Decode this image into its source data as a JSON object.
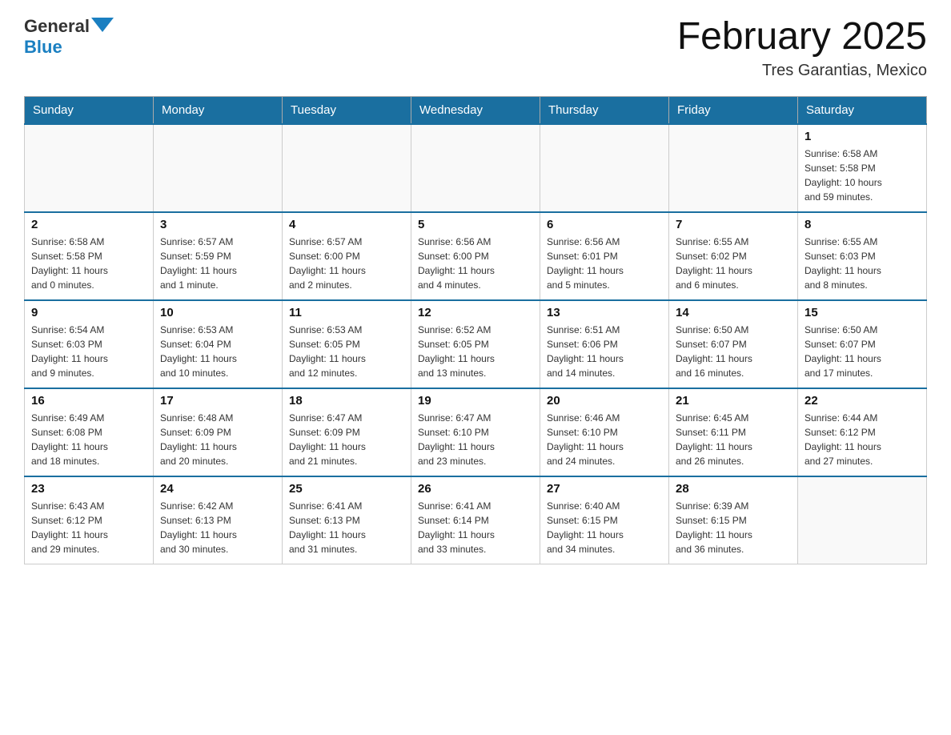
{
  "header": {
    "logo_general": "General",
    "logo_blue": "Blue",
    "month_title": "February 2025",
    "location": "Tres Garantias, Mexico"
  },
  "days_of_week": [
    "Sunday",
    "Monday",
    "Tuesday",
    "Wednesday",
    "Thursday",
    "Friday",
    "Saturday"
  ],
  "weeks": [
    [
      {
        "day": "",
        "info": ""
      },
      {
        "day": "",
        "info": ""
      },
      {
        "day": "",
        "info": ""
      },
      {
        "day": "",
        "info": ""
      },
      {
        "day": "",
        "info": ""
      },
      {
        "day": "",
        "info": ""
      },
      {
        "day": "1",
        "info": "Sunrise: 6:58 AM\nSunset: 5:58 PM\nDaylight: 10 hours\nand 59 minutes."
      }
    ],
    [
      {
        "day": "2",
        "info": "Sunrise: 6:58 AM\nSunset: 5:58 PM\nDaylight: 11 hours\nand 0 minutes."
      },
      {
        "day": "3",
        "info": "Sunrise: 6:57 AM\nSunset: 5:59 PM\nDaylight: 11 hours\nand 1 minute."
      },
      {
        "day": "4",
        "info": "Sunrise: 6:57 AM\nSunset: 6:00 PM\nDaylight: 11 hours\nand 2 minutes."
      },
      {
        "day": "5",
        "info": "Sunrise: 6:56 AM\nSunset: 6:00 PM\nDaylight: 11 hours\nand 4 minutes."
      },
      {
        "day": "6",
        "info": "Sunrise: 6:56 AM\nSunset: 6:01 PM\nDaylight: 11 hours\nand 5 minutes."
      },
      {
        "day": "7",
        "info": "Sunrise: 6:55 AM\nSunset: 6:02 PM\nDaylight: 11 hours\nand 6 minutes."
      },
      {
        "day": "8",
        "info": "Sunrise: 6:55 AM\nSunset: 6:03 PM\nDaylight: 11 hours\nand 8 minutes."
      }
    ],
    [
      {
        "day": "9",
        "info": "Sunrise: 6:54 AM\nSunset: 6:03 PM\nDaylight: 11 hours\nand 9 minutes."
      },
      {
        "day": "10",
        "info": "Sunrise: 6:53 AM\nSunset: 6:04 PM\nDaylight: 11 hours\nand 10 minutes."
      },
      {
        "day": "11",
        "info": "Sunrise: 6:53 AM\nSunset: 6:05 PM\nDaylight: 11 hours\nand 12 minutes."
      },
      {
        "day": "12",
        "info": "Sunrise: 6:52 AM\nSunset: 6:05 PM\nDaylight: 11 hours\nand 13 minutes."
      },
      {
        "day": "13",
        "info": "Sunrise: 6:51 AM\nSunset: 6:06 PM\nDaylight: 11 hours\nand 14 minutes."
      },
      {
        "day": "14",
        "info": "Sunrise: 6:50 AM\nSunset: 6:07 PM\nDaylight: 11 hours\nand 16 minutes."
      },
      {
        "day": "15",
        "info": "Sunrise: 6:50 AM\nSunset: 6:07 PM\nDaylight: 11 hours\nand 17 minutes."
      }
    ],
    [
      {
        "day": "16",
        "info": "Sunrise: 6:49 AM\nSunset: 6:08 PM\nDaylight: 11 hours\nand 18 minutes."
      },
      {
        "day": "17",
        "info": "Sunrise: 6:48 AM\nSunset: 6:09 PM\nDaylight: 11 hours\nand 20 minutes."
      },
      {
        "day": "18",
        "info": "Sunrise: 6:47 AM\nSunset: 6:09 PM\nDaylight: 11 hours\nand 21 minutes."
      },
      {
        "day": "19",
        "info": "Sunrise: 6:47 AM\nSunset: 6:10 PM\nDaylight: 11 hours\nand 23 minutes."
      },
      {
        "day": "20",
        "info": "Sunrise: 6:46 AM\nSunset: 6:10 PM\nDaylight: 11 hours\nand 24 minutes."
      },
      {
        "day": "21",
        "info": "Sunrise: 6:45 AM\nSunset: 6:11 PM\nDaylight: 11 hours\nand 26 minutes."
      },
      {
        "day": "22",
        "info": "Sunrise: 6:44 AM\nSunset: 6:12 PM\nDaylight: 11 hours\nand 27 minutes."
      }
    ],
    [
      {
        "day": "23",
        "info": "Sunrise: 6:43 AM\nSunset: 6:12 PM\nDaylight: 11 hours\nand 29 minutes."
      },
      {
        "day": "24",
        "info": "Sunrise: 6:42 AM\nSunset: 6:13 PM\nDaylight: 11 hours\nand 30 minutes."
      },
      {
        "day": "25",
        "info": "Sunrise: 6:41 AM\nSunset: 6:13 PM\nDaylight: 11 hours\nand 31 minutes."
      },
      {
        "day": "26",
        "info": "Sunrise: 6:41 AM\nSunset: 6:14 PM\nDaylight: 11 hours\nand 33 minutes."
      },
      {
        "day": "27",
        "info": "Sunrise: 6:40 AM\nSunset: 6:15 PM\nDaylight: 11 hours\nand 34 minutes."
      },
      {
        "day": "28",
        "info": "Sunrise: 6:39 AM\nSunset: 6:15 PM\nDaylight: 11 hours\nand 36 minutes."
      },
      {
        "day": "",
        "info": ""
      }
    ]
  ]
}
